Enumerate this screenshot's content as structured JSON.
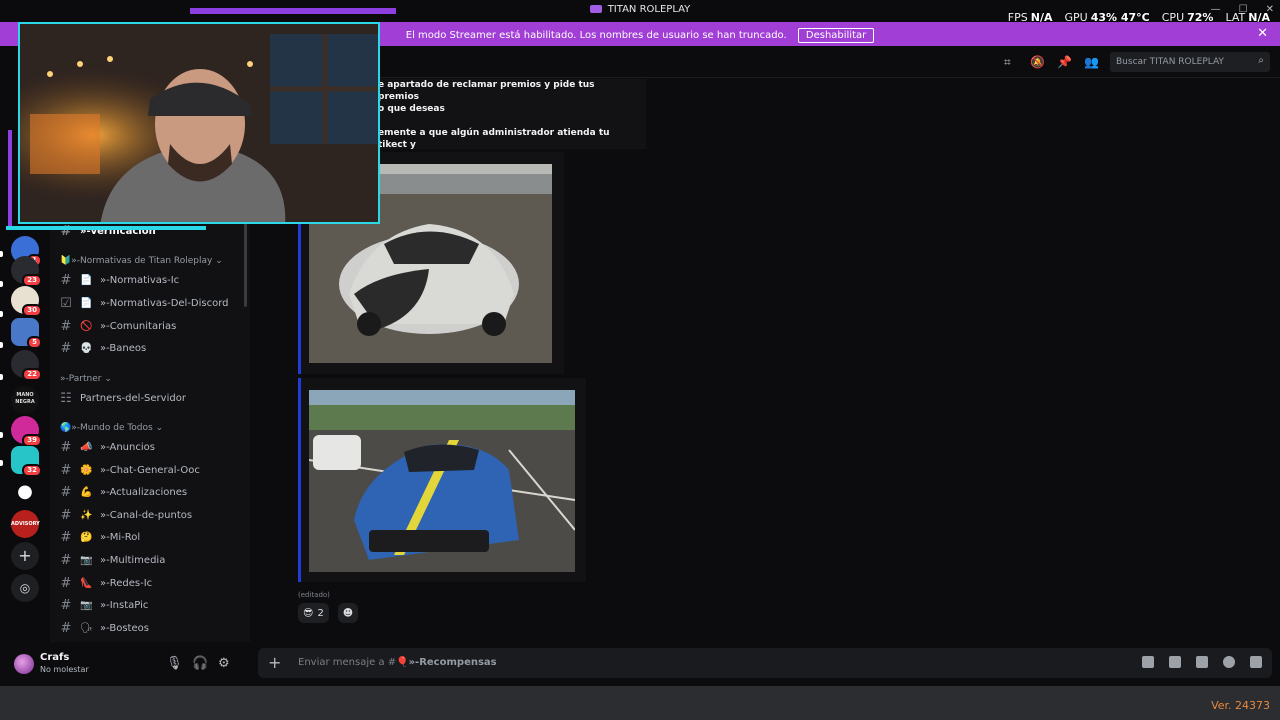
{
  "window": {
    "title": "TITAN ROLEPLAY",
    "controls": [
      "—",
      "☐",
      "✕"
    ]
  },
  "overlay_stats": [
    {
      "label": "FPS",
      "value": "N/A"
    },
    {
      "label": "GPU",
      "value": "43% 47°C"
    },
    {
      "label": "CPU",
      "value": "72%"
    },
    {
      "label": "LAT",
      "value": "N/A"
    }
  ],
  "banner": {
    "message": "El modo Streamer está habilitado. Los nombres de usuario se han truncado.",
    "button": "Deshabilitar",
    "close": "✕"
  },
  "server_rail": {
    "badges": [
      "1",
      "23",
      "30",
      "5",
      "22",
      "39",
      "32"
    ],
    "logo_text": "MANO NEGRA",
    "advisory_text": "ADVISORY"
  },
  "sidebar": {
    "partial_channel": "»-verificacion",
    "categories": [
      "»-Normativas de Titan Roleplay",
      "»-Partner",
      "»-Mundo de Todos"
    ],
    "channels": [
      {
        "emoji": "📄",
        "name": "»-Normativas-Ic"
      },
      {
        "emoji": "📄",
        "name": "»-Normativas-Del-Discord"
      },
      {
        "emoji": "🚫",
        "name": "»-Comunitarias"
      },
      {
        "emoji": "💀",
        "name": "»-Baneos"
      },
      {
        "emoji": "",
        "name": "Partners-del-Servidor"
      },
      {
        "emoji": "📣",
        "name": "»-Anuncios"
      },
      {
        "emoji": "🌼",
        "name": "»-Chat-General-Ooc"
      },
      {
        "emoji": "💪",
        "name": "»-Actualizaciones"
      },
      {
        "emoji": "✨",
        "name": "»-Canal-de-puntos"
      },
      {
        "emoji": "🤔",
        "name": "»-Mi-Rol"
      },
      {
        "emoji": "📷",
        "name": "»-Multimedia"
      },
      {
        "emoji": "👠",
        "name": "»-Redes-Ic"
      },
      {
        "emoji": "📷",
        "name": "»-InstaPic"
      },
      {
        "emoji": "🗣",
        "name": "»-Bosteos"
      }
    ]
  },
  "user": {
    "name": "Crafs",
    "status": "No molestar"
  },
  "header": {
    "search_placeholder": "Buscar TITAN ROLEPLAY"
  },
  "message": {
    "text_line1": "e apartado de reclamar premios y pide tus premios",
    "text_line2": "o que deseas",
    "text_line3": "emente a que algún administrador atienda tu tikect y",
    "text_line4": "..",
    "edited": "(editado)",
    "reaction_count": "2"
  },
  "composer": {
    "placeholder": "Enviar mensaje a #",
    "channel": "»-Recompensas"
  },
  "taskbar": {
    "version": "Ver. 24373"
  },
  "colors": {
    "banner": "#a13ed6",
    "embed_accent": "#1f3bd8",
    "cam_border": "#2bd8e8",
    "version": "#e8893d"
  }
}
